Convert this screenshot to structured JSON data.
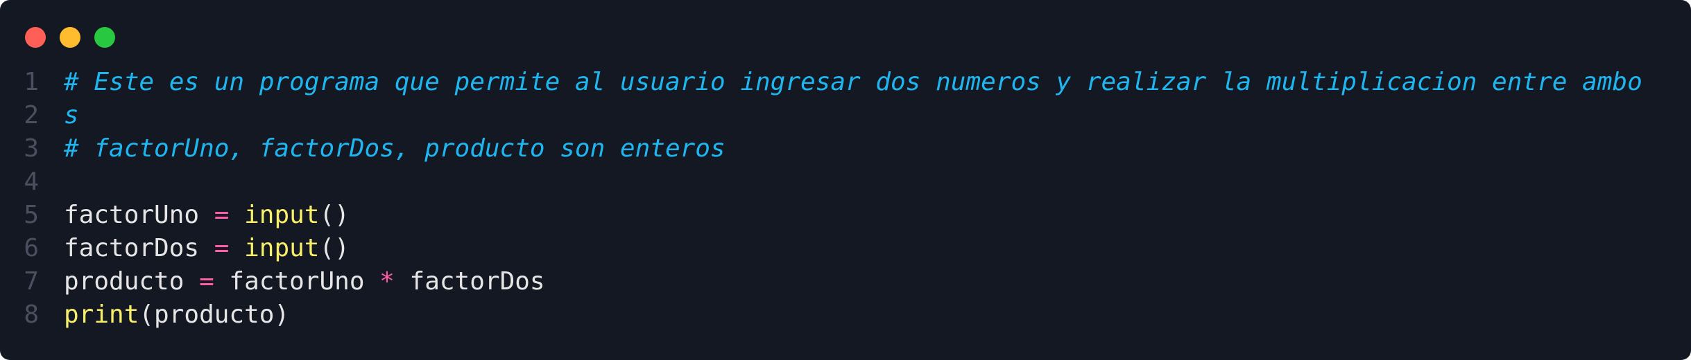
{
  "window": {
    "controls": [
      {
        "name": "close",
        "color": "#ff5f57"
      },
      {
        "name": "minimize",
        "color": "#febc2e"
      },
      {
        "name": "maximize",
        "color": "#28c840"
      }
    ]
  },
  "code": {
    "language": "python",
    "lines": [
      {
        "number": "1",
        "comment": "# Este es un programa que permite al usuario ingresar dos numeros y realizar la multiplicacion entre ambo"
      },
      {
        "number": "2",
        "comment": "s"
      },
      {
        "number": "3",
        "comment": "# factorUno, factorDos, producto son enteros"
      },
      {
        "number": "4"
      },
      {
        "number": "5",
        "var": "factorUno",
        "op": " = ",
        "fn": "input",
        "args": "()"
      },
      {
        "number": "6",
        "var": "factorDos",
        "op": " = ",
        "fn": "input",
        "args": "()"
      },
      {
        "number": "7",
        "var": "producto",
        "op1": " = ",
        "a": "factorUno",
        "op2": " * ",
        "b": "factorDos"
      },
      {
        "number": "8",
        "fn": "print",
        "args": "(producto)"
      }
    ]
  },
  "colors": {
    "background": "#141823",
    "comment": "#1fb6f0",
    "operator": "#ff5ca7",
    "function": "#f7ee6a",
    "text": "#e6e6e6",
    "line_number": "#4a5060"
  }
}
